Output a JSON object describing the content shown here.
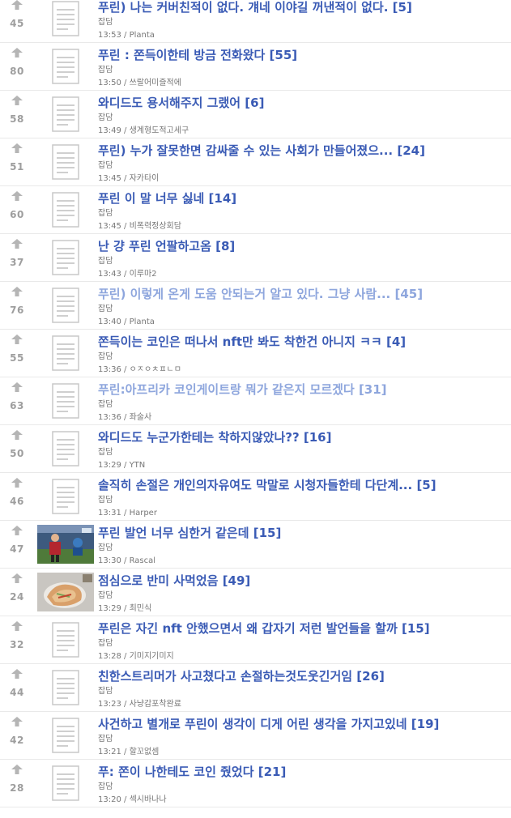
{
  "posts": [
    {
      "score": "45",
      "title": "푸린) 나는 커버친적이 없다. 걔네 이야길 꺼낸적이 없다.",
      "comments": "[5]",
      "category": "잡담",
      "time": "13:53",
      "author": "Planta",
      "thumb": "doc",
      "visited": false
    },
    {
      "score": "80",
      "title": "푸린 : 쫀득이한테 방금 전화왔다",
      "comments": "[55]",
      "category": "잡담",
      "time": "13:50",
      "author": "쓰랄어미즐적에",
      "thumb": "doc",
      "visited": false
    },
    {
      "score": "58",
      "title": "와디드도 용서해주지 그랬어",
      "comments": "[6]",
      "category": "잡담",
      "time": "13:49",
      "author": "생계형도적고세구",
      "thumb": "doc",
      "visited": false
    },
    {
      "score": "51",
      "title": "푸린) 누가 잘못한면 감싸줄 수 있는 사회가 만들어졌으...",
      "comments": "[24]",
      "category": "잡담",
      "time": "13:45",
      "author": "자카타이",
      "thumb": "doc",
      "visited": false
    },
    {
      "score": "60",
      "title": "푸린 이 말 너무 싫네",
      "comments": "[14]",
      "category": "잡담",
      "time": "13:45",
      "author": "비폭력정상회담",
      "thumb": "doc",
      "visited": false
    },
    {
      "score": "37",
      "title": "난 걍 푸린 언팔하고옴",
      "comments": "[8]",
      "category": "잡담",
      "time": "13:43",
      "author": "이루마2",
      "thumb": "doc",
      "visited": false
    },
    {
      "score": "76",
      "title": "푸린) 이렇게 온게 도움 안되는거 알고 있다. 그냥 사람...",
      "comments": "[45]",
      "category": "잡담",
      "time": "13:40",
      "author": "Planta",
      "thumb": "doc",
      "visited": true
    },
    {
      "score": "55",
      "title": "쫀득이는 코인은 떠나서 nft만 봐도 착한건 아니지 ㅋㅋ",
      "comments": "[4]",
      "category": "잡담",
      "time": "13:36",
      "author": "ㅇㅈㅇㅊㅍㄴㅁ",
      "thumb": "doc",
      "visited": false
    },
    {
      "score": "63",
      "title": "푸린:아프리카 코인게이트랑 뭐가 같은지 모르겠다",
      "comments": "[31]",
      "category": "잡담",
      "time": "13:36",
      "author": "좌술사",
      "thumb": "doc",
      "visited": true
    },
    {
      "score": "50",
      "title": "와디드도 누군가한테는 착하지않았나??",
      "comments": "[16]",
      "category": "잡담",
      "time": "13:29",
      "author": "YTN",
      "thumb": "doc",
      "visited": false
    },
    {
      "score": "46",
      "title": "솔직히 손절은 개인의자유여도 막말로 시청자들한테 다단계...",
      "comments": "[5]",
      "category": "잡담",
      "time": "13:31",
      "author": "Harper",
      "thumb": "doc",
      "visited": false
    },
    {
      "score": "47",
      "title": "푸린 발언 너무 심한거 같은데",
      "comments": "[15]",
      "category": "잡담",
      "time": "13:30",
      "author": "Rascal",
      "thumb": "photo-soccer",
      "visited": false
    },
    {
      "score": "24",
      "title": "점심으로 반미 사먹었음",
      "comments": "[49]",
      "category": "잡담",
      "time": "13:29",
      "author": "최민식",
      "thumb": "photo-food",
      "visited": false
    },
    {
      "score": "32",
      "title": "푸린은 자긴 nft 안했으면서 왜 갑자기 저런 발언들을 할까",
      "comments": "[15]",
      "category": "잡담",
      "time": "13:28",
      "author": "기미지기미지",
      "thumb": "doc",
      "visited": false
    },
    {
      "score": "44",
      "title": "친한스트리머가 사고쳤다고 손절하는것도웃긴거임",
      "comments": "[26]",
      "category": "잡담",
      "time": "13:23",
      "author": "사냥감포착완료",
      "thumb": "doc",
      "visited": false
    },
    {
      "score": "42",
      "title": "사건하고 별개로 푸린이 생각이 디게 어린 생각을 가지고있네",
      "comments": "[19]",
      "category": "잡담",
      "time": "13:21",
      "author": "할꼬없셈",
      "thumb": "doc",
      "visited": false
    },
    {
      "score": "28",
      "title": "푸: 쫀이 나한테도 코인 줬었다",
      "comments": "[21]",
      "category": "잡담",
      "time": "13:20",
      "author": "섹시바나나",
      "thumb": "doc",
      "visited": false
    }
  ],
  "colors": {
    "title": "#3a5bb5",
    "title_visited": "#8ea6dd",
    "score": "#9e9e9e",
    "meta": "#777777"
  },
  "icons": {
    "vote": "upvote-arrow-icon",
    "thumb_default": "document-icon"
  }
}
